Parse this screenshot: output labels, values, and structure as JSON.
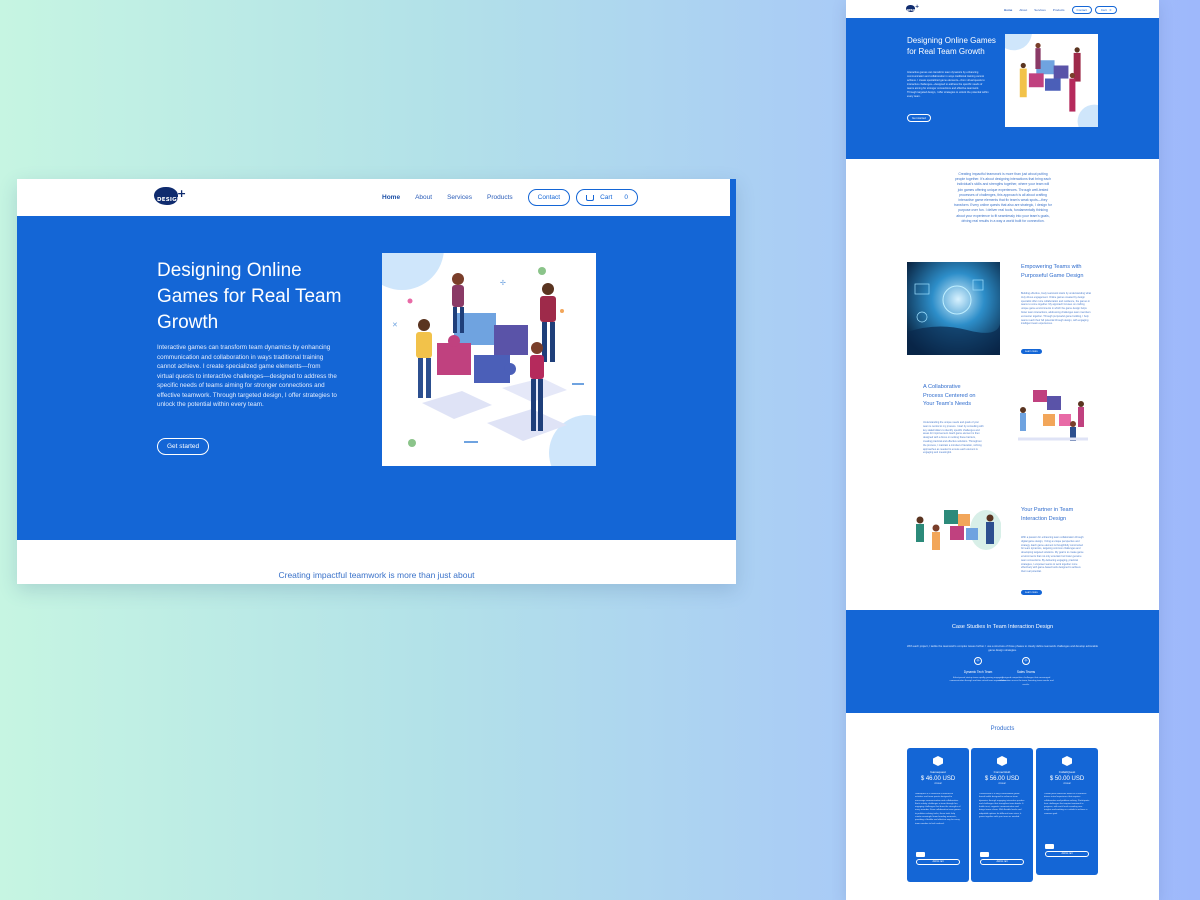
{
  "brand": {
    "logo_text": "DESIGN",
    "logo_mark": "+"
  },
  "nav": {
    "home": "Home",
    "about": "About",
    "services": "Services",
    "products": "Products",
    "contact": "Contact",
    "cart": "Cart",
    "cart_count": "0"
  },
  "hero": {
    "title": "Designing Online Games for Real Team Growth",
    "body": "Interactive games can transform team dynamics by enhancing communication and collaboration in ways traditional training cannot achieve. I create specialized game elements—from virtual quests to interactive challenges—designed to address the specific needs of teams aiming for stronger connections and effective teamwork. Through targeted design, I offer strategies to unlock the potential within every team.",
    "cta": "Get started"
  },
  "intro": {
    "text": "Creating impactful teamwork is more than just about",
    "full_text": "Creating impactful teamwork is more than just about putting people together. It's about designing interactions that bring each individual's skills and strengths together, where your team will join games offering unique experiences. Through well-tested processes of challenges, this approach is all about crafting interactive game elements that fix team's weak spots—they transform. Every online quests that also are strategic, I design for purpose over fun. I deliver real tools, fundamentally thinking about your experience to fit seamlessly into your team's goals, driving real results in a way a world built for connection."
  },
  "features": [
    {
      "title": "Empowering Teams with Purposeful Game Design",
      "body": "Building effective, lively teamwork starts by understanding what truly drives engagement. Online games created by design specialist offer more collaboration and resilience, the games in teams to come together. My approach focuses on crafting unique game environments in which the game design helps foster team interactions, addressing challenges team members encounter together. Through purposeful game building, I help teams reach their full potential through design, with engaging intelligent team experiences.",
      "cta": "Learn more"
    },
    {
      "title": "A Collaborative Process Centered on Your Team's Needs",
      "body": "Understanding the unique needs and goals of your team is central to my process. I start by consulting with key stakeholders to identify specific challenges and areas for improvement. Each game element is then designed with a focus on solving these barriers, creating practical and effective solutions. Throughout the process, I maintain a mindset of iteration, refining approaches as needed to ensure each element is engaging and meaningful."
    },
    {
      "title": "Your Partner in Team Interaction Design",
      "body": "With a passion for enhancing team collaboration through digital game design, I bring a unique perspective and strategy. Each game element is thoughtfully constructed for team dynamics, targeting common challenges and developing targeted solutions. My goal is to create game environments that not only entertain but foster genuine team connections. By delivering engaging, practical strategies, I empower teams to work together more effectively with game-based tools designed to achieve their real potential.",
      "cta": "Learn more"
    }
  ],
  "cases": {
    "title": "Case Studies In Team Interaction Design",
    "subtitle": "With each project, I tackle the teamwork's complex issues further. I use a structure of three phases to clearly define teamwork challenges and develop actionable game design strategies.",
    "items": [
      {
        "name": "Dynamic Tech Team",
        "desc": "A fast-paced startup team rapidly growing engaging communication through real-time virtual team experiences."
      },
      {
        "name": "Sales Teams",
        "desc": "Designed competitive challenges that encouraged collaboration across the team, boosting team morale and results."
      }
    ]
  },
  "products": {
    "title": "Products",
    "items": [
      {
        "name": "Gamequest",
        "price": "$ 46.00 USD",
        "period": "Annual",
        "desc": "Gamequest is a collection of interactive activities and team quests designed to encourage communication and collaboration. Each activity challenges a team through fun, engaging challenges that draw the strengths of every member. From collaborative team games to problem-solving tasks, these tools help create meaningful team bonding moments, providing a flexible and effective way for every team member to feel involved.",
        "cta": "Add to cart"
      },
      {
        "name": "ConnectHub",
        "price": "$ 56.00 USD",
        "period": "Annual",
        "desc": "ConnectHub is a fully customizable game-based toolkit designed to enhance team dynamics through engaging interactive puzzles and challenges that strengthen team bonds. It builds trust, supports communication and brings teams closer. With flexible levels and adaptable options for different team sizes, it grows together with your team as needed.",
        "cta": "Add to cart"
      },
      {
        "name": "CollabQuest",
        "price": "$ 50.00 USD",
        "period": "Annual",
        "desc": "CollabQuest immerses teams in a narrative-driven virtual experience that requires collaboration and problem-solving. Participants face challenges that require teamwork to progress, with each level revealing new insights and working as a whole to achieve a common goal.",
        "cta": "Add to cart"
      }
    ]
  },
  "colors": {
    "primary": "#1466d6",
    "accent_text": "#3a72c9",
    "navy": "#0f2b6e"
  }
}
